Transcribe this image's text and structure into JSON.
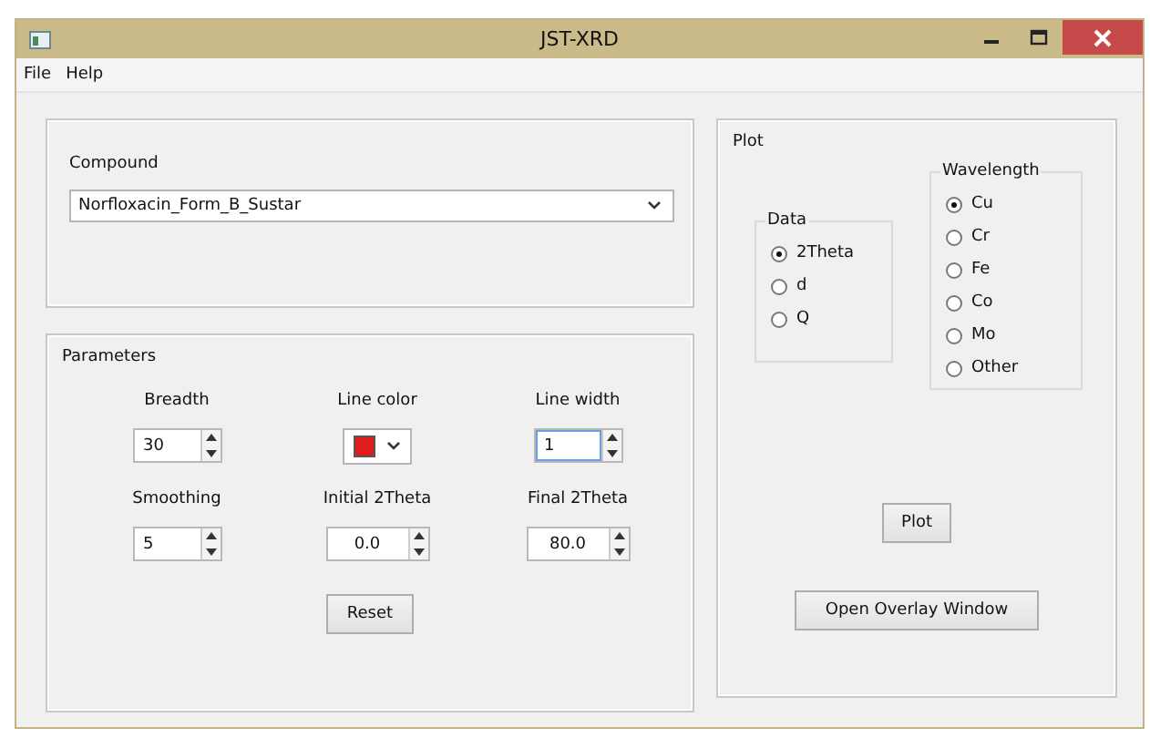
{
  "window": {
    "title": "JST-XRD"
  },
  "menu": [
    {
      "label": "File"
    },
    {
      "label": "Help"
    }
  ],
  "compound": {
    "label": "Compound",
    "value": "Norfloxacin_Form_B_Sustar"
  },
  "parameters": {
    "title": "Parameters",
    "fields": [
      {
        "kind": "spin",
        "label": "Breadth",
        "value": "30",
        "focused": false
      },
      {
        "kind": "color",
        "label": "Line color",
        "color": "#e01c1c"
      },
      {
        "kind": "spin",
        "label": "Line width",
        "value": "1",
        "focused": true
      },
      {
        "kind": "spin",
        "label": "Smoothing",
        "value": "5",
        "focused": false
      },
      {
        "kind": "decimal",
        "label": "Initial 2Theta",
        "value": "0.0",
        "focused": false
      },
      {
        "kind": "decimal",
        "label": "Final 2Theta",
        "value": "80.0",
        "focused": false
      }
    ],
    "reset": "Reset"
  },
  "plot": {
    "title": "Plot",
    "data": {
      "title": "Data",
      "options": [
        {
          "label": "2Theta",
          "selected": true
        },
        {
          "label": "d",
          "selected": false
        },
        {
          "label": "Q",
          "selected": false
        }
      ]
    },
    "wavelength": {
      "title": "Wavelength",
      "options": [
        {
          "label": "Cu",
          "selected": true
        },
        {
          "label": "Cr",
          "selected": false
        },
        {
          "label": "Fe",
          "selected": false
        },
        {
          "label": "Co",
          "selected": false
        },
        {
          "label": "Mo",
          "selected": false
        },
        {
          "label": "Other",
          "selected": false
        }
      ]
    },
    "plot_button": "Plot",
    "overlay_button": "Open Overlay Window"
  }
}
